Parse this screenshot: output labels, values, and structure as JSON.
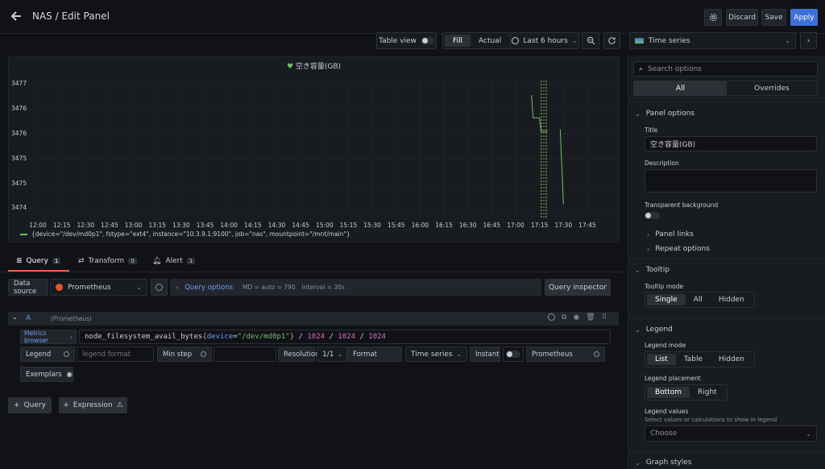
{
  "header": {
    "title": "NAS / Edit Panel",
    "discard_label": "Discard",
    "save_label": "Save",
    "apply_label": "Apply"
  },
  "toolbar": {
    "table_view_label": "Table view",
    "fill_label": "Fill",
    "actual_label": "Actual",
    "time_range_label": "Last 6 hours",
    "visualization_label": "Time series"
  },
  "panel": {
    "title": "空き容量(GB)",
    "legend_text": "{device=\"/dev/md0p1\", fstype=\"ext4\", instance=\"10.3.9.1:9100\", job=\"nas\", mountpoint=\"/mnt/main\"}"
  },
  "chart_data": {
    "type": "line",
    "y_ticks": [
      "3477",
      "3476",
      "3476",
      "3475",
      "3475",
      "3474"
    ],
    "x_ticks": [
      "12:00",
      "12:15",
      "12:30",
      "12:45",
      "13:00",
      "13:15",
      "13:30",
      "13:45",
      "14:00",
      "14:15",
      "14:30",
      "14:45",
      "15:00",
      "15:15",
      "15:30",
      "15:45",
      "16:00",
      "16:15",
      "16:30",
      "16:45",
      "17:00",
      "17:15",
      "17:30",
      "17:45"
    ],
    "series": [
      {
        "color": "#73bf69",
        "points": [
          [
            "16:50",
            3476.5
          ],
          [
            "17:10",
            3476.5
          ],
          [
            "17:11",
            3476.0
          ],
          [
            "17:15",
            3476.0
          ],
          [
            "17:16",
            3475.7
          ],
          [
            "17:20",
            3475.7
          ],
          [
            "17:28",
            3475.75
          ],
          [
            "17:30",
            3474.1
          ],
          [
            "17:46",
            3474.1
          ]
        ]
      }
    ],
    "grid": true,
    "legend_placement": "bottom"
  },
  "tabs": [
    {
      "label": "Query",
      "count": "1"
    },
    {
      "label": "Transform",
      "count": "0"
    },
    {
      "label": "Alert",
      "count": "1"
    }
  ],
  "datasource": {
    "label": "Data source",
    "value": "Prometheus",
    "query_options_label": "Query options",
    "md_text": "MD = auto = 790",
    "interval_text": "Interval = 30s",
    "inspector_label": "Query inspector"
  },
  "query": {
    "ref": "A",
    "source": "(Prometheus)",
    "metrics_browser_label": "Metrics browser",
    "expr": {
      "metric": "node_filesystem_avail_bytes",
      "open": "{",
      "label_key": "device",
      "eq": "=",
      "label_val": "\"/dev/md0p1\"",
      "close": "}",
      "rest_op1": " / ",
      "n1": "1024",
      "rest_op2": " / ",
      "n2": "1024",
      "rest_op3": " / ",
      "n3": "1024"
    },
    "legend_label": "Legend",
    "legend_placeholder": "legend format",
    "min_step_label": "Min step",
    "resolution_label": "Resolution",
    "resolution_value": "1/1",
    "format_label": "Format",
    "format_value": "Time series",
    "instant_label": "Instant",
    "prometheus_label": "Prometheus",
    "exemplars_label": "Exemplars",
    "add_query_label": "Query",
    "add_expression_label": "Expression"
  },
  "options": {
    "search_placeholder": "Search options",
    "tab_all": "All",
    "tab_overrides": "Overrides",
    "panel_options_title": "Panel options",
    "title_label": "Title",
    "title_value": "空き容量(GB)",
    "description_label": "Description",
    "transparent_label": "Transparent background",
    "panel_links_label": "Panel links",
    "repeat_options_label": "Repeat options",
    "tooltip_title": "Tooltip",
    "tooltip_mode_label": "Tooltip mode",
    "tooltip_modes": [
      "Single",
      "All",
      "Hidden"
    ],
    "legend_title": "Legend",
    "legend_mode_label": "Legend mode",
    "legend_modes": [
      "List",
      "Table",
      "Hidden"
    ],
    "legend_placement_label": "Legend placement",
    "legend_placements": [
      "Bottom",
      "Right"
    ],
    "legend_values_label": "Legend values",
    "legend_values_desc": "Select values or calculations to show in legend",
    "legend_values_placeholder": "Choose",
    "graph_styles_title": "Graph styles"
  }
}
